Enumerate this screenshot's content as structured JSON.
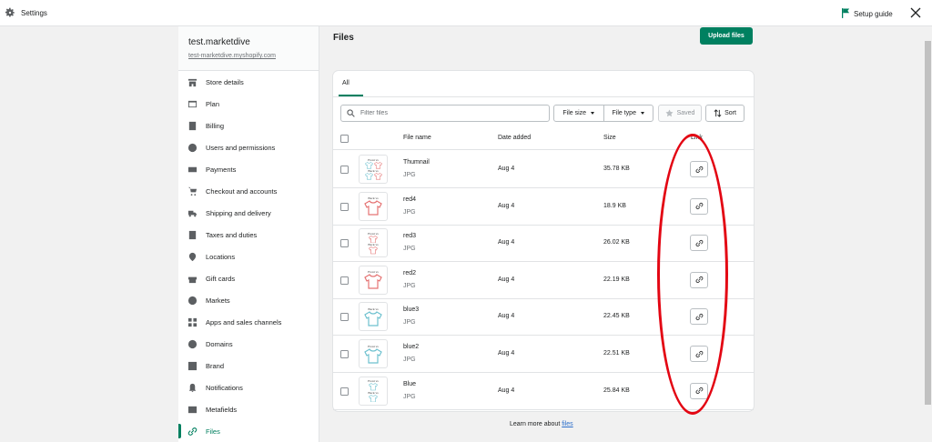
{
  "topbar": {
    "title": "Settings",
    "setup_guide": "Setup guide",
    "settings_icon": "gear-icon",
    "flag_icon": "flag-icon",
    "close_icon": "close-icon"
  },
  "store": {
    "name": "test.marketdive",
    "url": "test-marketdive.myshopify.com"
  },
  "sidebar": {
    "items": [
      {
        "label": "Store details",
        "icon": "store-icon"
      },
      {
        "label": "Plan",
        "icon": "plan-icon"
      },
      {
        "label": "Billing",
        "icon": "billing-icon"
      },
      {
        "label": "Users and permissions",
        "icon": "user-icon"
      },
      {
        "label": "Payments",
        "icon": "payments-icon"
      },
      {
        "label": "Checkout and accounts",
        "icon": "cart-icon"
      },
      {
        "label": "Shipping and delivery",
        "icon": "truck-icon"
      },
      {
        "label": "Taxes and duties",
        "icon": "tax-icon"
      },
      {
        "label": "Locations",
        "icon": "location-icon"
      },
      {
        "label": "Gift cards",
        "icon": "gift-icon"
      },
      {
        "label": "Markets",
        "icon": "globe-icon"
      },
      {
        "label": "Apps and sales channels",
        "icon": "apps-icon"
      },
      {
        "label": "Domains",
        "icon": "domain-icon"
      },
      {
        "label": "Brand",
        "icon": "brand-icon"
      },
      {
        "label": "Notifications",
        "icon": "bell-icon"
      },
      {
        "label": "Metafields",
        "icon": "metafields-icon"
      },
      {
        "label": "Files",
        "icon": "link-icon",
        "active": true
      }
    ]
  },
  "page": {
    "title": "Files",
    "upload_label": "Upload files"
  },
  "tabs": [
    {
      "label": "All",
      "selected": true
    }
  ],
  "toolbar": {
    "filter_placeholder": "Filter files",
    "file_size": "File size",
    "file_type": "File type",
    "saved": "Saved",
    "sort": "Sort"
  },
  "table": {
    "headers": {
      "name": "File name",
      "date": "Date added",
      "size": "Size",
      "link": "Link"
    },
    "rows": [
      {
        "name": "Thumnail",
        "type": "JPG",
        "date": "Aug 4",
        "size": "35.78 KB",
        "thumb_text": [
          "Front vs",
          "Back vs"
        ],
        "colors": [
          "#6ec1cf",
          "#e57373"
        ],
        "count": 4
      },
      {
        "name": "red4",
        "type": "JPG",
        "date": "Aug 4",
        "size": "18.9 KB",
        "thumb_text": [
          "Back vs"
        ],
        "colors": [
          "#e57373"
        ],
        "count": 1
      },
      {
        "name": "red3",
        "type": "JPG",
        "date": "Aug 4",
        "size": "26.02 KB",
        "thumb_text": [
          "Front vs",
          "Back vs"
        ],
        "colors": [
          "#e57373"
        ],
        "count": 2
      },
      {
        "name": "red2",
        "type": "JPG",
        "date": "Aug 4",
        "size": "22.19 KB",
        "thumb_text": [
          "Front vs"
        ],
        "colors": [
          "#e57373"
        ],
        "count": 1
      },
      {
        "name": "blue3",
        "type": "JPG",
        "date": "Aug 4",
        "size": "22.45 KB",
        "thumb_text": [
          "Back vs"
        ],
        "colors": [
          "#6ec1cf"
        ],
        "count": 1
      },
      {
        "name": "blue2",
        "type": "JPG",
        "date": "Aug 4",
        "size": "22.51 KB",
        "thumb_text": [
          "Front vs"
        ],
        "colors": [
          "#6ec1cf"
        ],
        "count": 1
      },
      {
        "name": "Blue",
        "type": "JPG",
        "date": "Aug 4",
        "size": "25.84 KB",
        "thumb_text": [
          "Front vs",
          "Back vs"
        ],
        "colors": [
          "#6ec1cf"
        ],
        "count": 2
      }
    ]
  },
  "footer": {
    "learn_prefix": "Learn more about ",
    "learn_link": "files"
  },
  "colors": {
    "accent": "#008060",
    "annotation": "#e30613",
    "link": "#2c6ecb"
  }
}
